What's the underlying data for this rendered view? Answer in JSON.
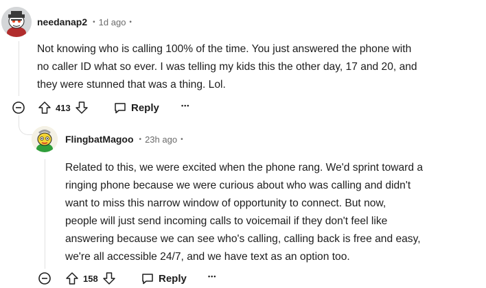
{
  "comments": [
    {
      "username": "needanap2",
      "sep": "•",
      "age": "1d ago",
      "sep2": "•",
      "lines": [
        "Not knowing who is calling 100% of the time. You just answered the phone with",
        "no caller ID what so ever. I was telling my kids this the other day, 17 and 20, and",
        "they were stunned that was a thing. Lol."
      ],
      "votes": "413",
      "reply_label": "Reply",
      "more": "•••",
      "colors": {
        "avatar_bg": "#dadada"
      }
    },
    {
      "username": "FlingbatMagoo",
      "sep": "•",
      "age": "23h ago",
      "sep2": "•",
      "lines": [
        "Related to this, we were excited when the phone rang. We'd sprint toward a",
        "ringing phone because we were curious about who was calling and didn't",
        "want to miss this narrow window of opportunity to connect. But now,",
        "people will just send incoming calls to voicemail if they don't feel like",
        "answering because we can see who's calling, calling back is free and easy,",
        "we're all accessible 24/7, and we have text as an option too."
      ],
      "votes": "158",
      "reply_label": "Reply",
      "more": "•••",
      "colors": {
        "avatar_bg": "#fbe7a0"
      }
    }
  ]
}
